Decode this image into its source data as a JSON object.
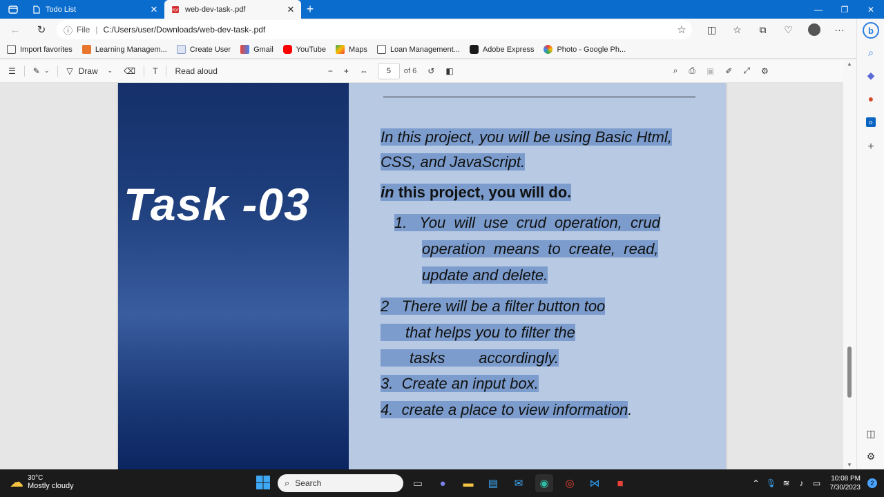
{
  "tabs": [
    {
      "title": "Todo List",
      "active": false
    },
    {
      "title": "web-dev-task-.pdf",
      "active": true
    }
  ],
  "address": {
    "scheme": "File",
    "url": "C:/Users/user/Downloads/web-dev-task-.pdf"
  },
  "favorites": [
    "Import favorites",
    "Learning Managem...",
    "Create User",
    "Gmail",
    "YouTube",
    "Maps",
    "Loan Management...",
    "Adobe Express",
    "Photo - Google Ph..."
  ],
  "pdf_toolbar": {
    "draw_label": "Draw",
    "read_aloud_label": "Read aloud",
    "page_current": "5",
    "page_total": "of 6"
  },
  "document": {
    "task_title": "Task -03",
    "lines": [
      "In this project, you will be using Basic Html,",
      "CSS, and JavaScript.",
      "in",
      "this project, you will do.",
      "1.   You  will  use  crud  operation,  crud",
      "operation  means  to  create,  read,",
      "update and delete.",
      "2   There will be a filter button too",
      "that helps you to filter the",
      "tasks        accordingly.",
      "3.  Create an input box.",
      "4.  create a place to view information",
      "."
    ]
  },
  "taskbar": {
    "temperature": "30°C",
    "condition": "Mostly cloudy",
    "search_placeholder": "Search",
    "time": "10:08 PM",
    "date": "7/30/2023",
    "notification_count": "2"
  },
  "colors": {
    "tabstrip": "#0a6ccd",
    "page_background": "#b8c9e4",
    "highlight": "#7b9ccc",
    "panel_dark": "#15306a"
  }
}
